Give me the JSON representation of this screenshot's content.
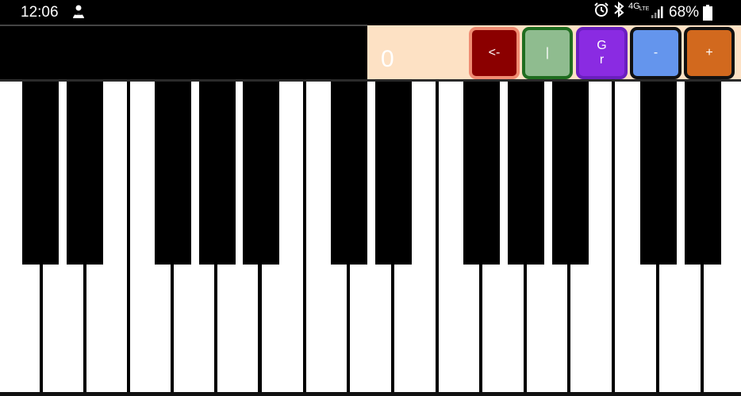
{
  "status_bar": {
    "time": "12:06",
    "network": "4G",
    "network_sub": "LTE",
    "battery": "68%",
    "icons": [
      "notification-icon",
      "alarm-icon",
      "bluetooth-icon",
      "signal-icon",
      "battery-icon"
    ]
  },
  "toolbar": {
    "counter": "0",
    "buttons": {
      "back": "<-",
      "bar": "|",
      "gr_line1": "G",
      "gr_line2": "r",
      "minus": "-",
      "plus": "+"
    }
  },
  "colors": {
    "panel_bg": "#fde1c4",
    "back_bg": "#8b0000",
    "bar_bg": "#8fbc8f",
    "gr_bg": "#8a2be2",
    "minus_bg": "#6495ed",
    "plus_bg": "#d2691e"
  },
  "keyboard": {
    "white_key_count": 17,
    "black_key_count": 12
  }
}
